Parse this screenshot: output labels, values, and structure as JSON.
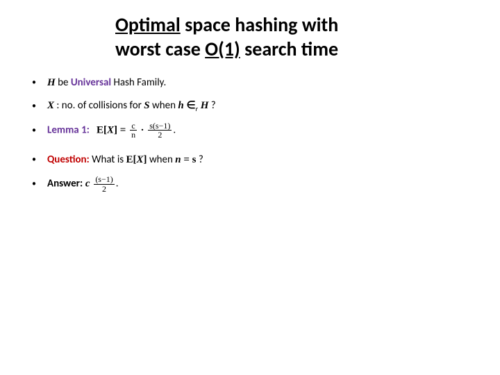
{
  "title": {
    "line1a": "Optimal",
    "line1b": " space hashing with",
    "line2a": "worst case ",
    "line2b": "O(1)",
    "line2c": " search time"
  },
  "rows": {
    "r1": {
      "H": "H",
      "be": " be ",
      "Universal": "Universal",
      "rest": " Hash Family."
    },
    "r2": {
      "X": "X",
      "mid": " : no. of collisions for ",
      "S": "S",
      "when": " when ",
      "h": "h",
      "inr": " ∈",
      "rsub": "r",
      "H2": " H",
      "q": " ?"
    },
    "r3": {
      "label": "Lemma 1:",
      "E": "E[",
      "X": "X",
      "close": "] = ",
      "c": "c",
      "n": "n",
      "dot": " · ",
      "num": "s(s−1)",
      "den": "2",
      "period": "."
    },
    "r4": {
      "label": "Question:",
      "what": " What is ",
      "E": "E[",
      "X": "X",
      "close": "]",
      "when": " when ",
      "n": "n",
      "eq": " = s",
      "q": " ?"
    },
    "r5": {
      "label": "Answer:",
      "c": " c ",
      "num": "(s−1)",
      "den": "2",
      "period": "."
    }
  }
}
